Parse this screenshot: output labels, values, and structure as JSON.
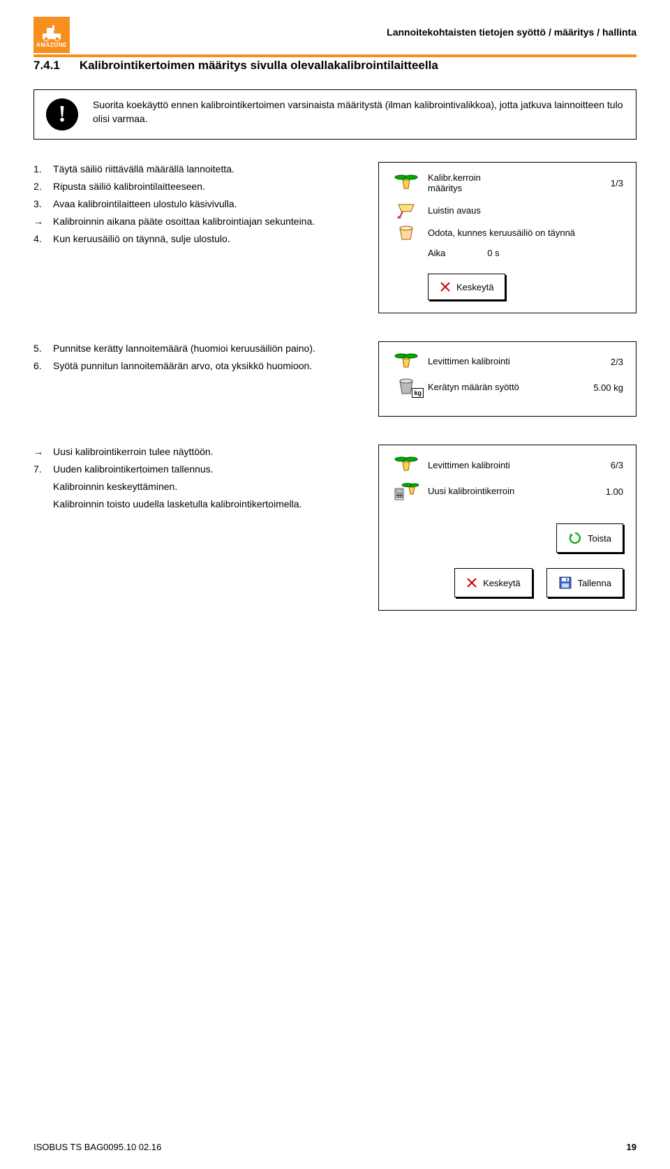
{
  "header": {
    "logo_text": "AMAZONE",
    "breadcrumb": "Lannoitekohtaisten tietojen syöttö / määritys / hallinta"
  },
  "section": {
    "number": "7.4.1",
    "title": "Kalibrointikertoimen määritys sivulla olevallakalibrointilaitteella"
  },
  "info": {
    "text": "Suorita koekäyttö ennen kalibrointikertoimen varsinaista määritystä (ilman kalibrointivalikkoa), jotta jatkuva lainnoitteen tulo olisi varmaa."
  },
  "block1": {
    "steps": [
      {
        "bullet": "1.",
        "text": "Täytä säiliö riittävällä määrällä lannoitetta."
      },
      {
        "bullet": "2.",
        "text": "Ripusta säiliö kalibrointilaitteeseen."
      },
      {
        "bullet": "3.",
        "text": "Avaa kalibrointilaitteen ulostulo käsivivulla."
      },
      {
        "bullet": "→",
        "text": "Kalibroinnin aikana pääte osoittaa kalibrointiajan sekunteina."
      },
      {
        "bullet": "4.",
        "text": "Kun keruusäiliö on täynnä, sulje ulostulo."
      }
    ],
    "panel": {
      "title_line1": "Kalibr.kerroin",
      "title_line2": "määritys",
      "page": "1/3",
      "open_label": "Luistin avaus",
      "wait_label": "Odota, kunnes keruusäiliö on täynnä",
      "time_label": "Aika",
      "time_value": "0 s",
      "cancel_label": "Keskeytä"
    }
  },
  "block2": {
    "steps": [
      {
        "bullet": "5.",
        "text": "Punnitse kerätty lannoitemäärä (huomioi keruusäiliön paino)."
      },
      {
        "bullet": "6.",
        "text": "Syötä punnitun lannoitemäärän arvo, ota yksikkö huomioon."
      }
    ],
    "panel": {
      "title": "Levittimen kalibrointi",
      "page": "2/3",
      "input_label": "Kerätyn määrän syöttö",
      "value": "5.00 kg"
    }
  },
  "block3": {
    "steps": [
      {
        "bullet": "→",
        "text": "Uusi kalibrointikerroin tulee näyttöön."
      },
      {
        "bullet": "7.",
        "text": "Uuden kalibrointikertoimen tallennus."
      },
      {
        "bullet": "",
        "text": "Kalibroinnin keskeyttäminen."
      },
      {
        "bullet": "",
        "text": "Kalibroinnin toisto uudella lasketulla kalibrointikertoimella."
      }
    ],
    "panel": {
      "title": "Levittimen kalibrointi",
      "page": "6/3",
      "new_label": "Uusi kalibrointikerroin",
      "value": "1.00",
      "repeat_label": "Toista",
      "cancel_label": "Keskeytä",
      "save_label": "Tallenna"
    }
  },
  "footer": {
    "doc_id": "ISOBUS TS  BAG0095.10  02.16",
    "page": "19"
  }
}
